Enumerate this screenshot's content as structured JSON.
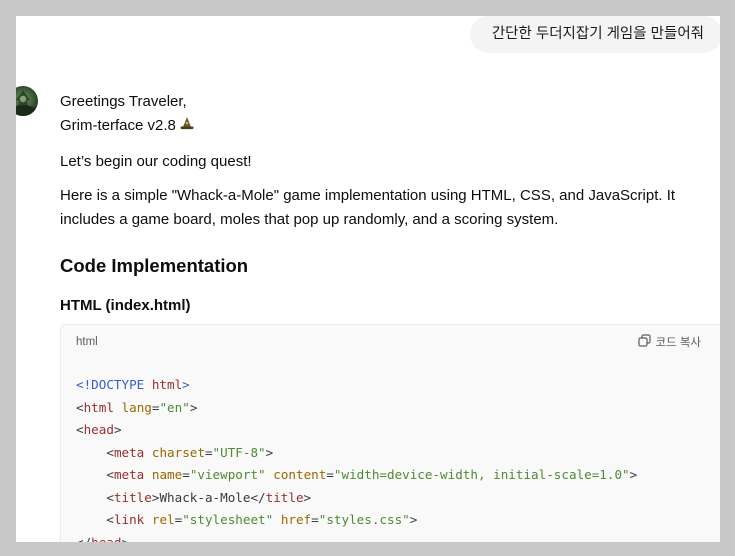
{
  "user_message": "간단한 두더지잡기 게임을 만들어줘",
  "assistant": {
    "greeting": "Greetings Traveler,",
    "version": "Grim-terface v2.8",
    "intro": "Let’s begin our coding quest!",
    "description_line1": "Here is a simple \"Whack-a-Mole\" game implementation using HTML, CSS, and JavaScript. It",
    "description_line2": "includes a game board, moles that pop up randomly, and a scoring system.",
    "heading": "Code Implementation",
    "subheading": "HTML (index.html)"
  },
  "code_block": {
    "language": "html",
    "copy_label": "코드 복사",
    "lines": [
      {
        "indent": "",
        "open": "<!DOCTYPE ",
        "tag": "html",
        "close": ">"
      },
      {
        "indent": "",
        "tag": "html",
        "attr1": "lang",
        "val1": "\"en\""
      },
      {
        "indent": "",
        "tag": "head"
      },
      {
        "indent": "    ",
        "tag": "meta",
        "attr1": "charset",
        "val1": "\"UTF-8\""
      },
      {
        "indent": "    ",
        "tag": "meta",
        "attr1": "name",
        "val1": "\"viewport\"",
        "attr2": "content",
        "val2": "\"width=device-width, initial-scale=1.0\""
      },
      {
        "indent": "    ",
        "tag": "title",
        "text": "Whack-a-Mole",
        "end_tag": "title"
      },
      {
        "indent": "    ",
        "tag": "link",
        "attr1": "rel",
        "val1": "\"stylesheet\"",
        "attr2": "href",
        "val2": "\"styles.css\""
      },
      {
        "indent": "",
        "end_tag": "head"
      }
    ]
  },
  "colors": {
    "tag": "#9b2d2d",
    "attribute": "#986801",
    "string": "#4f8a34",
    "doctype": "#3a5ccc"
  }
}
